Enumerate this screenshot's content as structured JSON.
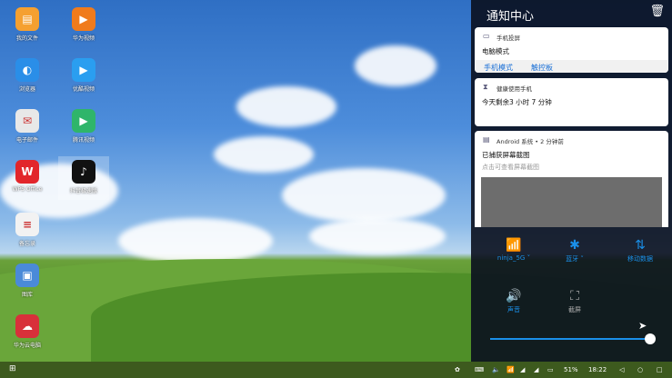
{
  "desktop": {
    "icons": [
      {
        "label": "我的文件",
        "glyph": "▤",
        "color": "#f5a030"
      },
      {
        "label": "华为视频",
        "glyph": "▶",
        "color": "#f07b1c"
      },
      {
        "label": "浏览器",
        "glyph": "◐",
        "color": "#2a8ee8"
      },
      {
        "label": "优酷视频",
        "glyph": "▶",
        "color": "#2a9ef0"
      },
      {
        "label": "电子邮件",
        "glyph": "✉",
        "color": "#e8e8e8"
      },
      {
        "label": "腾讯视频",
        "glyph": "▶",
        "color": "#2fb56a"
      },
      {
        "label": "WPS Office",
        "glyph": "W",
        "color": "#e2262b"
      },
      {
        "label": "抖音极速版",
        "glyph": "♪",
        "color": "#111"
      },
      {
        "label": "备忘录",
        "glyph": "≡",
        "color": "#f2f2f2"
      },
      {
        "label": "图库",
        "glyph": "▣",
        "color": "#4a8ad8"
      },
      {
        "label": "华为云电脑",
        "glyph": "☁",
        "color": "#d8303a"
      }
    ]
  },
  "panel": {
    "title": "通知中心",
    "cards": [
      {
        "app": "手机投屏",
        "title": "电脑模式",
        "actions": [
          "手机模式",
          "触控板"
        ]
      },
      {
        "app": "健康使用手机",
        "title": "今天剩余3 小时 7 分钟"
      },
      {
        "app": "Android 系统 • 2 分钟前",
        "title": "已捕获屏幕截图",
        "subtitle": "点击可查看屏幕截图"
      }
    ],
    "quick": [
      {
        "label": "ninja_5G ˅",
        "glyph": "📶"
      },
      {
        "label": "蓝牙 ˅",
        "glyph": "✱"
      },
      {
        "label": "移动数据",
        "glyph": "⇅"
      },
      {
        "label": "声音",
        "glyph": "🔊"
      },
      {
        "label": "截屏",
        "glyph": "⛶"
      }
    ],
    "brightness": 0.98
  },
  "taskbar": {
    "battery": "51%",
    "time": "18:22"
  }
}
